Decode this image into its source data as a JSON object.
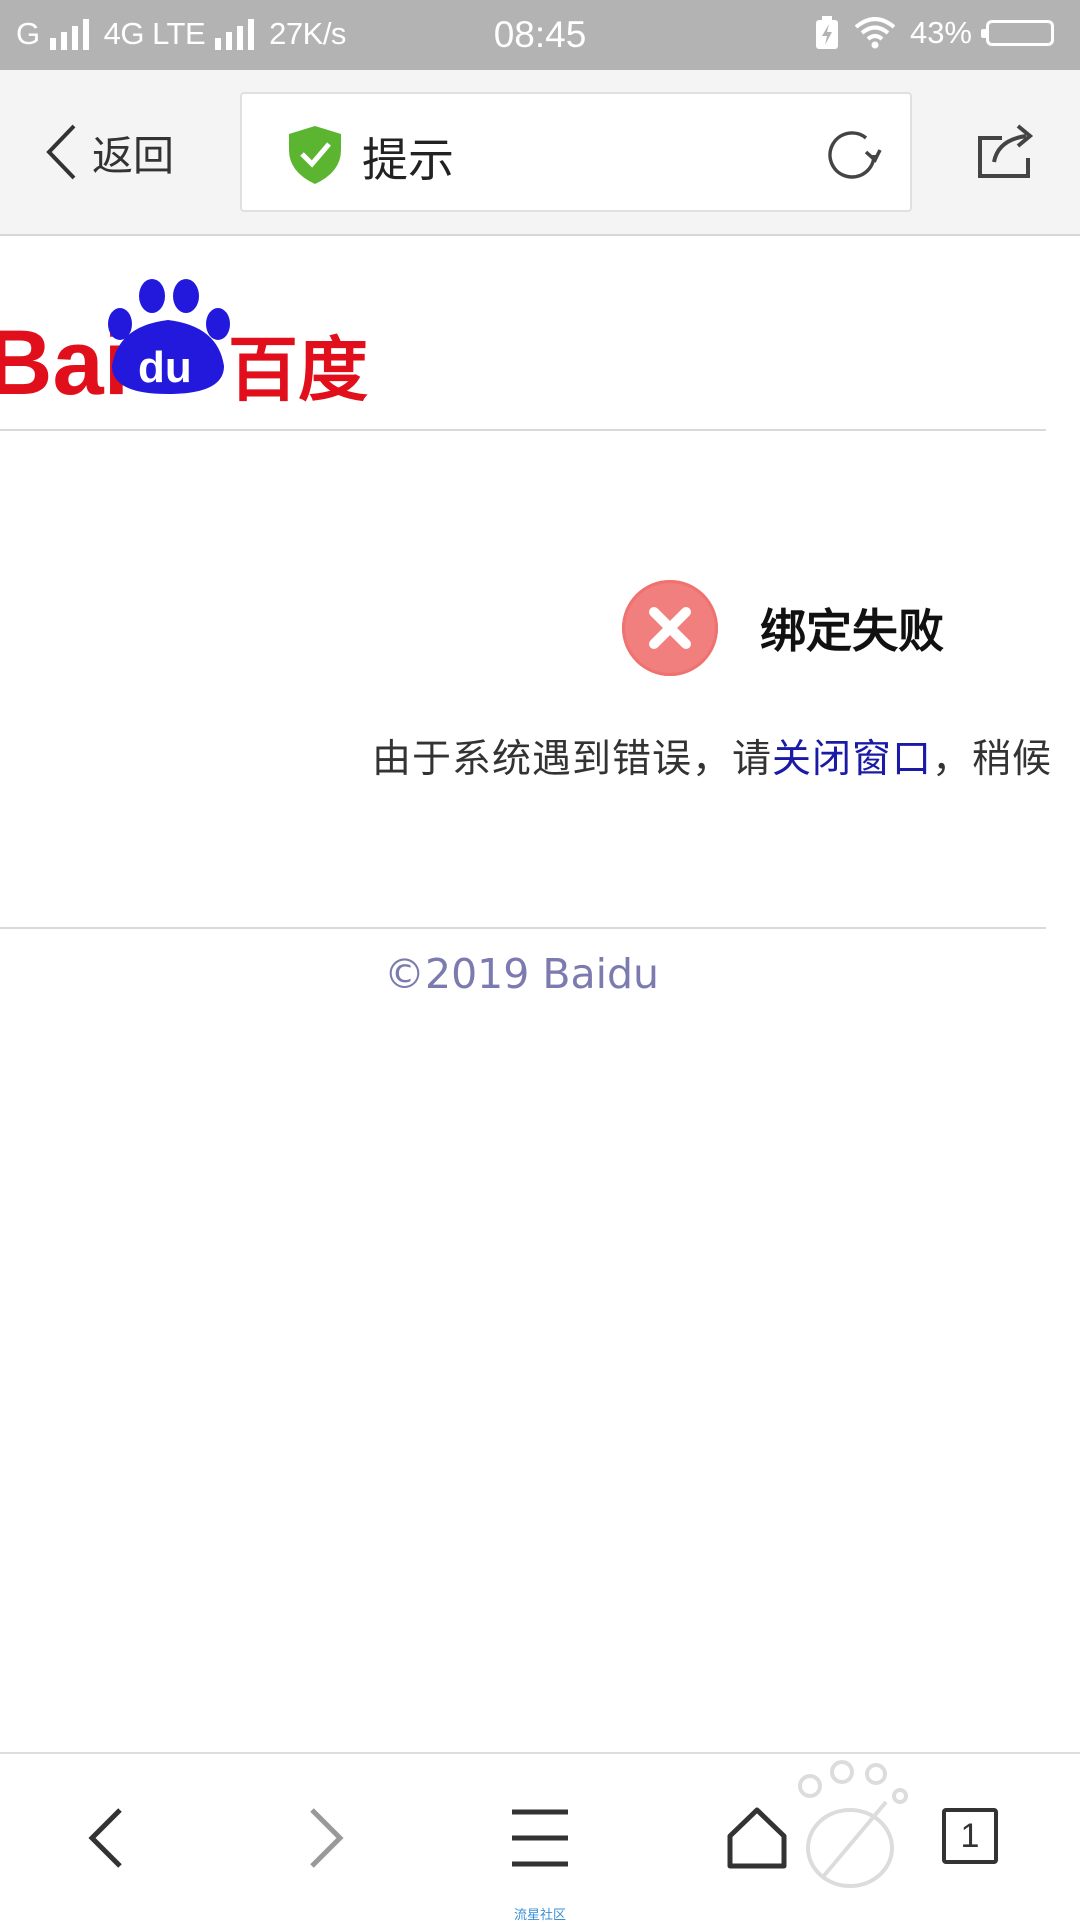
{
  "status_bar": {
    "network1": "G",
    "network2": "4G LTE",
    "speed": "27K/s",
    "time": "08:45",
    "battery": "43%"
  },
  "nav": {
    "back_label": "返回",
    "page_title": "提示"
  },
  "logo": {
    "text": "Bai",
    "paw_text": "du",
    "cn_text": "百度",
    "brand_red": "#e10f1b",
    "brand_blue": "#2319dc"
  },
  "error": {
    "title": "绑定失败",
    "message_prefix": "由于系统遇到错误，请",
    "link_text": "关闭窗口",
    "message_suffix": "，稍候"
  },
  "footer": {
    "copyright": "©2019 Baidu"
  },
  "toolbar": {
    "tab_count": "1",
    "community_label": "流星社区"
  },
  "colors": {
    "status_bar": "#b3b3b3",
    "shield_green": "#5cb531",
    "error_red": "#f17f7d",
    "link": "#1a1aa6"
  }
}
